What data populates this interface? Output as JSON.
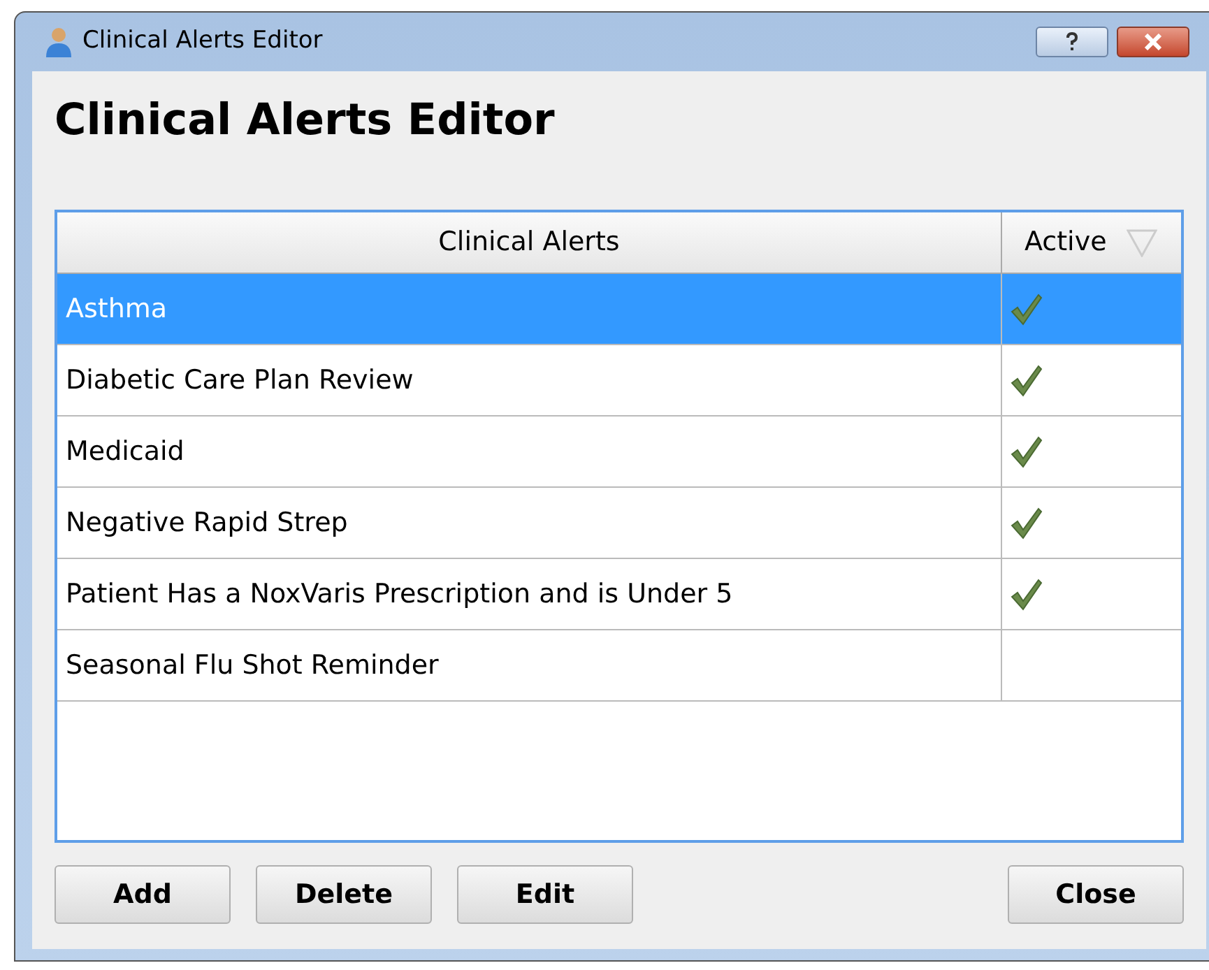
{
  "window": {
    "title": "Clinical Alerts Editor"
  },
  "heading": "Clinical Alerts Editor",
  "table": {
    "columns": [
      "Clinical Alerts",
      "Active"
    ],
    "rows": [
      {
        "name": "Asthma",
        "active": true,
        "selected": true
      },
      {
        "name": "Diabetic Care Plan Review",
        "active": true,
        "selected": false
      },
      {
        "name": "Medicaid",
        "active": true,
        "selected": false
      },
      {
        "name": "Negative Rapid Strep",
        "active": true,
        "selected": false
      },
      {
        "name": "Patient Has a NoxVaris Prescription and is Under 5",
        "active": true,
        "selected": false
      },
      {
        "name": "Seasonal Flu Shot Reminder",
        "active": false,
        "selected": false
      }
    ]
  },
  "buttons": [
    "Add",
    "Delete",
    "Edit"
  ],
  "close_button": "Close"
}
